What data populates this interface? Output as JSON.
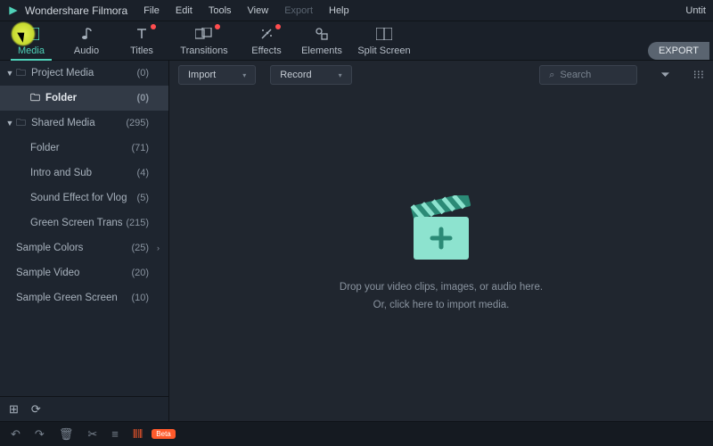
{
  "titlebar": {
    "app_name": "Wondershare Filmora",
    "menu": [
      "File",
      "Edit",
      "Tools",
      "View",
      "Export",
      "Help"
    ],
    "menu_disabled_index": 4,
    "doc_title": "Untit"
  },
  "tooltabs": {
    "items": [
      {
        "label": "Media",
        "icon": "media-icon",
        "dot": false,
        "active": true
      },
      {
        "label": "Audio",
        "icon": "audio-icon",
        "dot": false
      },
      {
        "label": "Titles",
        "icon": "titles-icon",
        "dot": true
      },
      {
        "label": "Transitions",
        "icon": "transitions-icon",
        "dot": true
      },
      {
        "label": "Effects",
        "icon": "effects-icon",
        "dot": true
      },
      {
        "label": "Elements",
        "icon": "elements-icon",
        "dot": false
      },
      {
        "label": "Split Screen",
        "icon": "splitscreen-icon",
        "dot": false
      }
    ],
    "export_label": "EXPORT"
  },
  "sidebar": {
    "tree": [
      {
        "label": "Project Media",
        "count": "(0)",
        "chev": "▼",
        "folder": true,
        "depth": 0
      },
      {
        "label": "Folder",
        "count": "(0)",
        "folder": true,
        "depth": 1,
        "selected": true
      },
      {
        "label": "Shared Media",
        "count": "(295)",
        "chev": "▼",
        "folder": true,
        "depth": 0
      },
      {
        "label": "Folder",
        "count": "(71)",
        "depth": 1
      },
      {
        "label": "Intro and Sub",
        "count": "(4)",
        "depth": 1
      },
      {
        "label": "Sound Effect for Vlog",
        "count": "(5)",
        "depth": 1
      },
      {
        "label": "Green Screen Trans",
        "count": "(215)",
        "depth": 1
      },
      {
        "label": "Sample Colors",
        "count": "(25)",
        "depth": 0,
        "arrow": true
      },
      {
        "label": "Sample Video",
        "count": "(20)",
        "depth": 0
      },
      {
        "label": "Sample Green Screen",
        "count": "(10)",
        "depth": 0
      }
    ],
    "footer_icons": [
      "add-folder-icon",
      "refresh-icon"
    ]
  },
  "content": {
    "import_label": "Import",
    "record_label": "Record",
    "search_placeholder": "Search",
    "drop_line1": "Drop your video clips, images, or audio here.",
    "drop_line2": "Or, click here to import media."
  },
  "bottombar": {
    "icons": [
      "undo-icon",
      "redo-icon",
      "delete-icon",
      "cut-icon",
      "settings-icon",
      "timeline-icon"
    ],
    "beta_label": "Beta"
  },
  "colors": {
    "accent": "#4fd1b8"
  }
}
